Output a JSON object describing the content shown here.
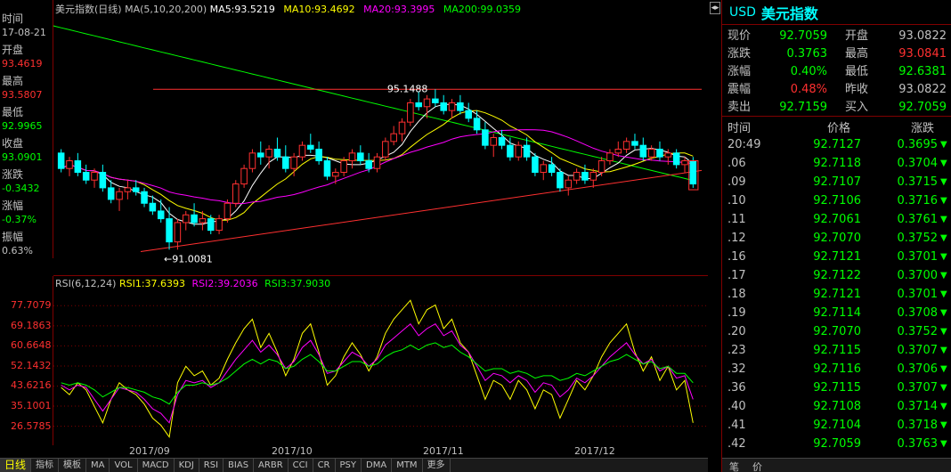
{
  "left_panel": {
    "items": [
      {
        "label": "时间",
        "value": "17-08-21",
        "color": "#c0c0c0"
      },
      {
        "label": "开盘",
        "value": "93.4619",
        "color": "#ff3030"
      },
      {
        "label": "最高",
        "value": "93.5807",
        "color": "#ff3030"
      },
      {
        "label": "最低",
        "value": "92.9965",
        "color": "#00ff00"
      },
      {
        "label": "收盘",
        "value": "93.0901",
        "color": "#00ff00"
      },
      {
        "label": "涨跌",
        "value": "-0.3432",
        "color": "#00ff00"
      },
      {
        "label": "涨幅",
        "value": "-0.37%",
        "color": "#00ff00"
      },
      {
        "label": "振幅",
        "value": "0.63%",
        "color": "#c0c0c0"
      }
    ]
  },
  "main_title": {
    "name": "美元指数(日线)",
    "ma_params": "MA(5,10,20,200)",
    "ma5": "MA5:93.5219",
    "ma10": "MA10:93.4692",
    "ma20": "MA20:93.3995",
    "ma200": "MA200:99.0359"
  },
  "main_annotations": {
    "high_label": "95.1488",
    "low_label": "91.0081"
  },
  "rsi_title": {
    "params": "RSI(6,12,24)",
    "rsi1": "RSI1:37.6393",
    "rsi2": "RSI2:39.2036",
    "rsi3": "RSI3:37.9030"
  },
  "rsi_ticks": [
    "77.7079",
    "69.1863",
    "60.6648",
    "52.1432",
    "43.6216",
    "35.1001",
    "26.5785"
  ],
  "date_axis": [
    "2017/09",
    "2017/10",
    "2017/11",
    "2017/12"
  ],
  "tabs": [
    "日线",
    "指标",
    "模板",
    "MA",
    "VOL",
    "MACD",
    "KDJ",
    "RSI",
    "BIAS",
    "ARBR",
    "CCI",
    "CR",
    "PSY",
    "DMA",
    "MTM",
    "更多"
  ],
  "scroll_button": "◂▸",
  "right_panel": {
    "symbol": "USD",
    "name": "美元指数",
    "quote_rows": [
      {
        "l1": "现价",
        "v1": "92.7059",
        "c1": "#00ff00",
        "l2": "开盘",
        "v2": "93.0822",
        "c2": "#c0c0c0"
      },
      {
        "l1": "涨跌",
        "v1": "0.3763",
        "c1": "#00ff00",
        "l2": "最高",
        "v2": "93.0841",
        "c2": "#ff3030"
      },
      {
        "l1": "涨幅",
        "v1": "0.40%",
        "c1": "#00ff00",
        "l2": "最低",
        "v2": "92.6381",
        "c2": "#00ff00"
      },
      {
        "l1": "震幅",
        "v1": "0.48%",
        "c1": "#ff3030",
        "l2": "昨收",
        "v2": "93.0822",
        "c2": "#c0c0c0"
      },
      {
        "l1": "卖出",
        "v1": "92.7159",
        "c1": "#00ff00",
        "l2": "买入",
        "v2": "92.7059",
        "c2": "#00ff00"
      }
    ],
    "tick_header": {
      "time": "时间",
      "price": "价格",
      "change": "涨跌"
    },
    "ticks": [
      {
        "time": "20:49",
        "price": "92.7127",
        "change": "0.3695"
      },
      {
        "time": ".06",
        "price": "92.7118",
        "change": "0.3704"
      },
      {
        "time": ".09",
        "price": "92.7107",
        "change": "0.3715"
      },
      {
        "time": ".10",
        "price": "92.7106",
        "change": "0.3716"
      },
      {
        "time": ".11",
        "price": "92.7061",
        "change": "0.3761"
      },
      {
        "time": ".12",
        "price": "92.7070",
        "change": "0.3752"
      },
      {
        "time": ".16",
        "price": "92.7121",
        "change": "0.3701"
      },
      {
        "time": ".17",
        "price": "92.7122",
        "change": "0.3700"
      },
      {
        "time": ".18",
        "price": "92.7121",
        "change": "0.3701"
      },
      {
        "time": ".19",
        "price": "92.7114",
        "change": "0.3708"
      },
      {
        "time": ".20",
        "price": "92.7070",
        "change": "0.3752"
      },
      {
        "time": ".23",
        "price": "92.7115",
        "change": "0.3707"
      },
      {
        "time": ".32",
        "price": "92.7116",
        "change": "0.3706"
      },
      {
        "time": ".36",
        "price": "92.7115",
        "change": "0.3707"
      },
      {
        "time": ".40",
        "price": "92.7108",
        "change": "0.3714"
      },
      {
        "time": ".41",
        "price": "92.7104",
        "change": "0.3718"
      },
      {
        "time": ".42",
        "price": "92.7059",
        "change": "0.3763"
      }
    ],
    "bottom_tabs": [
      "笔",
      "价"
    ]
  },
  "colors": {
    "up": "#ff3030",
    "down": "#00ffff",
    "ma5": "#ffffff",
    "ma10": "#ffff00",
    "ma20": "#ff00ff",
    "ma200": "#00ff00",
    "rsi1": "#ffff00",
    "rsi2": "#ff00ff",
    "rsi3": "#00ff00"
  },
  "chart_data": [
    {
      "type": "candlestick",
      "title": "美元指数(日线)",
      "series": [
        {
          "name": "MA5",
          "last": 93.5219
        },
        {
          "name": "MA10",
          "last": 93.4692
        },
        {
          "name": "MA20",
          "last": 93.3995
        },
        {
          "name": "MA200",
          "last": 99.0359
        }
      ],
      "x_labels": [
        "2017/09",
        "2017/10",
        "2017/11",
        "2017/12"
      ],
      "annotations": [
        "95.1488",
        "91.0081"
      ],
      "ylim": [
        90.5,
        97.0
      ],
      "candles": [
        [
          93.5,
          93.6,
          93.0,
          93.1
        ],
        [
          93.1,
          93.4,
          92.9,
          93.3
        ],
        [
          93.3,
          93.5,
          92.9,
          93.0
        ],
        [
          93.0,
          93.2,
          92.7,
          92.8
        ],
        [
          92.8,
          93.1,
          92.6,
          93.0
        ],
        [
          93.0,
          93.2,
          92.5,
          92.6
        ],
        [
          92.6,
          92.8,
          92.2,
          92.3
        ],
        [
          92.3,
          92.6,
          92.0,
          92.5
        ],
        [
          92.5,
          92.8,
          92.3,
          92.6
        ],
        [
          92.6,
          92.8,
          92.4,
          92.5
        ],
        [
          92.5,
          92.6,
          92.1,
          92.2
        ],
        [
          92.2,
          92.4,
          91.9,
          92.0
        ],
        [
          92.0,
          92.3,
          91.7,
          91.8
        ],
        [
          91.8,
          92.1,
          91.0,
          91.2
        ],
        [
          91.2,
          91.8,
          91.0,
          91.7
        ],
        [
          91.7,
          92.0,
          91.5,
          91.9
        ],
        [
          91.9,
          92.2,
          91.6,
          91.7
        ],
        [
          91.7,
          92.0,
          91.5,
          91.8
        ],
        [
          91.8,
          91.9,
          91.4,
          91.5
        ],
        [
          91.5,
          91.9,
          91.4,
          91.8
        ],
        [
          91.8,
          92.3,
          91.7,
          92.2
        ],
        [
          92.2,
          92.8,
          92.1,
          92.7
        ],
        [
          92.7,
          93.2,
          92.6,
          93.1
        ],
        [
          93.1,
          93.6,
          93.0,
          93.5
        ],
        [
          93.5,
          93.8,
          93.2,
          93.4
        ],
        [
          93.4,
          93.7,
          93.1,
          93.6
        ],
        [
          93.6,
          93.9,
          93.3,
          93.4
        ],
        [
          93.4,
          93.7,
          93.0,
          93.1
        ],
        [
          93.1,
          93.5,
          92.9,
          93.4
        ],
        [
          93.4,
          93.8,
          93.3,
          93.7
        ],
        [
          93.7,
          94.0,
          93.5,
          93.6
        ],
        [
          93.6,
          93.8,
          93.2,
          93.3
        ],
        [
          93.3,
          93.4,
          92.8,
          92.9
        ],
        [
          92.9,
          93.1,
          92.7,
          93.0
        ],
        [
          93.0,
          93.4,
          92.9,
          93.3
        ],
        [
          93.3,
          93.6,
          93.1,
          93.5
        ],
        [
          93.5,
          93.7,
          93.2,
          93.3
        ],
        [
          93.3,
          93.5,
          93.0,
          93.1
        ],
        [
          93.1,
          93.5,
          93.0,
          93.4
        ],
        [
          93.4,
          93.9,
          93.3,
          93.8
        ],
        [
          93.8,
          94.2,
          93.7,
          94.0
        ],
        [
          94.0,
          94.4,
          93.8,
          94.3
        ],
        [
          94.3,
          94.9,
          94.2,
          94.8
        ],
        [
          94.8,
          95.1,
          94.6,
          94.7
        ],
        [
          94.7,
          95.0,
          94.4,
          94.9
        ],
        [
          94.9,
          95.15,
          94.7,
          94.8
        ],
        [
          94.8,
          95.0,
          94.5,
          94.6
        ],
        [
          94.6,
          94.9,
          94.4,
          94.8
        ],
        [
          94.8,
          95.0,
          94.5,
          94.6
        ],
        [
          94.6,
          94.8,
          94.3,
          94.4
        ],
        [
          94.4,
          94.6,
          94.0,
          94.1
        ],
        [
          94.1,
          94.3,
          93.6,
          93.7
        ],
        [
          93.7,
          94.0,
          93.4,
          93.9
        ],
        [
          93.9,
          94.1,
          93.6,
          93.7
        ],
        [
          93.7,
          93.9,
          93.3,
          93.4
        ],
        [
          93.4,
          93.8,
          93.3,
          93.7
        ],
        [
          93.7,
          93.9,
          93.3,
          93.4
        ],
        [
          93.4,
          93.5,
          92.9,
          93.0
        ],
        [
          93.0,
          93.3,
          92.8,
          93.2
        ],
        [
          93.2,
          93.4,
          92.9,
          93.0
        ],
        [
          93.0,
          93.1,
          92.5,
          92.6
        ],
        [
          92.6,
          92.9,
          92.4,
          92.8
        ],
        [
          92.8,
          93.1,
          92.7,
          93.0
        ],
        [
          93.0,
          93.2,
          92.7,
          92.8
        ],
        [
          92.8,
          93.1,
          92.6,
          93.0
        ],
        [
          93.0,
          93.4,
          92.9,
          93.3
        ],
        [
          93.3,
          93.6,
          93.2,
          93.5
        ],
        [
          93.5,
          93.8,
          93.4,
          93.6
        ],
        [
          93.6,
          93.9,
          93.5,
          93.8
        ],
        [
          93.8,
          94.0,
          93.6,
          93.7
        ],
        [
          93.7,
          93.9,
          93.3,
          93.4
        ],
        [
          93.4,
          93.7,
          93.3,
          93.6
        ],
        [
          93.6,
          93.8,
          93.3,
          93.4
        ],
        [
          93.4,
          93.6,
          93.2,
          93.5
        ],
        [
          93.5,
          93.6,
          93.1,
          93.2
        ],
        [
          93.2,
          93.4,
          93.0,
          93.3
        ],
        [
          93.3,
          93.4,
          92.6,
          92.7
        ]
      ]
    },
    {
      "type": "line",
      "title": "RSI(6,12,24)",
      "ylim": [
        20,
        85
      ],
      "y_ticks": [
        77.7079,
        69.1863,
        60.6648,
        52.1432,
        43.6216,
        35.1001,
        26.5785
      ],
      "series": [
        {
          "name": "RSI1",
          "values": [
            43,
            40,
            45,
            42,
            35,
            28,
            38,
            45,
            42,
            40,
            36,
            30,
            27,
            22,
            45,
            52,
            48,
            50,
            44,
            47,
            55,
            62,
            68,
            72,
            60,
            66,
            58,
            48,
            55,
            66,
            70,
            58,
            44,
            48,
            56,
            62,
            57,
            50,
            56,
            66,
            72,
            76,
            80,
            70,
            76,
            78,
            68,
            72,
            62,
            58,
            48,
            38,
            46,
            44,
            38,
            46,
            42,
            34,
            42,
            40,
            30,
            38,
            46,
            42,
            48,
            56,
            62,
            66,
            70,
            58,
            50,
            56,
            46,
            52,
            42,
            46,
            28
          ]
        },
        {
          "name": "RSI2",
          "values": [
            44,
            42,
            44,
            43,
            38,
            33,
            38,
            43,
            42,
            41,
            38,
            34,
            32,
            28,
            40,
            46,
            45,
            46,
            43,
            45,
            50,
            55,
            59,
            63,
            58,
            61,
            57,
            51,
            54,
            60,
            63,
            57,
            49,
            50,
            54,
            58,
            56,
            52,
            55,
            61,
            64,
            67,
            70,
            65,
            68,
            70,
            65,
            67,
            61,
            58,
            52,
            46,
            49,
            48,
            45,
            48,
            46,
            41,
            45,
            44,
            39,
            42,
            47,
            45,
            48,
            52,
            56,
            59,
            62,
            57,
            53,
            55,
            50,
            52,
            47,
            48,
            38
          ]
        },
        {
          "name": "RSI3",
          "values": [
            45,
            44,
            45,
            44,
            42,
            39,
            41,
            43,
            43,
            42,
            41,
            39,
            38,
            36,
            41,
            44,
            44,
            45,
            44,
            45,
            47,
            50,
            53,
            55,
            53,
            55,
            54,
            51,
            52,
            55,
            57,
            54,
            50,
            50,
            52,
            54,
            54,
            52,
            53,
            56,
            58,
            59,
            61,
            59,
            61,
            62,
            60,
            61,
            58,
            56,
            53,
            50,
            51,
            51,
            49,
            50,
            49,
            47,
            48,
            48,
            46,
            47,
            49,
            48,
            50,
            52,
            54,
            55,
            57,
            55,
            53,
            54,
            51,
            52,
            49,
            49,
            45
          ]
        }
      ],
      "x_labels": [
        "2017/09",
        "2017/10",
        "2017/11",
        "2017/12"
      ]
    }
  ]
}
